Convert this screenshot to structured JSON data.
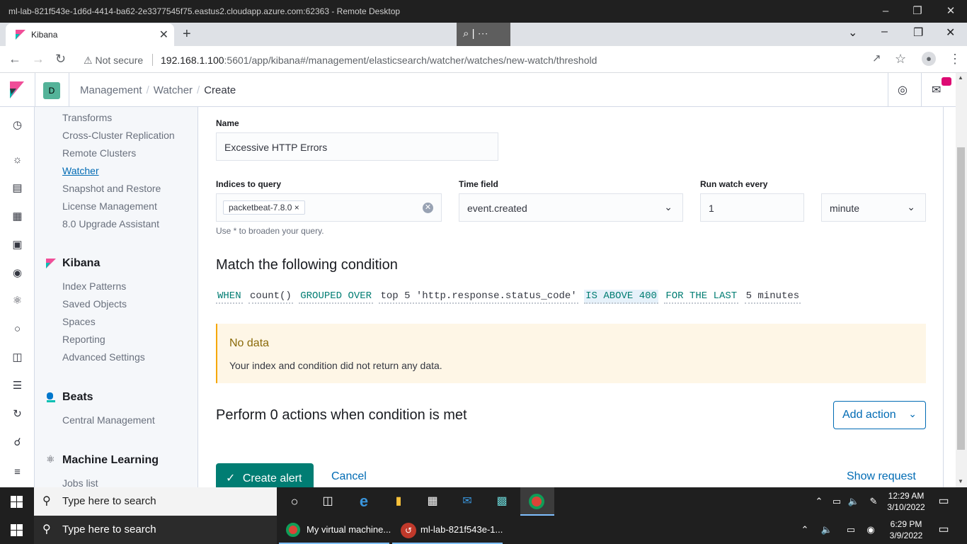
{
  "rdp": {
    "title": "ml-lab-821f543e-1d6d-4414-ba62-2e3377545f75.eastus2.cloudapp.azure.com:62363 - Remote Desktop",
    "zoom_label": "⌕ | ⋯"
  },
  "browser": {
    "tab_title": "Kibana",
    "security_label": "Not secure",
    "url_host": "192.168.1.100",
    "url_rest": ":5601/app/kibana#/management/elasticsearch/watcher/watches/new-watch/threshold"
  },
  "kibana_header": {
    "space_initial": "D",
    "breadcrumbs": [
      "Management",
      "Watcher",
      "Create"
    ]
  },
  "sidemenu": {
    "elasticsearch_items": [
      {
        "label": "Transforms"
      },
      {
        "label": "Cross-Cluster Replication"
      },
      {
        "label": "Remote Clusters"
      },
      {
        "label": "Watcher"
      },
      {
        "label": "Snapshot and Restore"
      },
      {
        "label": "License Management"
      },
      {
        "label": "8.0 Upgrade Assistant"
      }
    ],
    "kibana_heading": "Kibana",
    "kibana_items": [
      {
        "label": "Index Patterns"
      },
      {
        "label": "Saved Objects"
      },
      {
        "label": "Spaces"
      },
      {
        "label": "Reporting"
      },
      {
        "label": "Advanced Settings"
      }
    ],
    "beats_heading": "Beats",
    "beats_items": [
      {
        "label": "Central Management"
      }
    ],
    "ml_heading": "Machine Learning",
    "ml_items": [
      {
        "label": "Jobs list"
      }
    ]
  },
  "form": {
    "name_label": "Name",
    "name_value": "Excessive HTTP Errors",
    "indices_label": "Indices to query",
    "indices_badge": "packetbeat-7.8.0 ×",
    "indices_help": "Use * to broaden your query.",
    "time_field_label": "Time field",
    "time_field_value": "event.created",
    "run_every_label": "Run watch every",
    "run_every_value": "1",
    "run_every_unit": "minute"
  },
  "condition": {
    "heading": "Match the following condition",
    "when": "WHEN",
    "agg": "count()",
    "grouped": "GROUPED OVER",
    "group_value": "top 5 'http.response.status_code'",
    "threshold": "IS ABOVE 400",
    "for_the_last": "FOR THE LAST",
    "window": "5 minutes"
  },
  "callout": {
    "title": "No data",
    "text": "Your index and condition did not return any data."
  },
  "actions": {
    "heading": "Perform 0 actions when condition is met",
    "add_label": "Add action"
  },
  "footer": {
    "create_label": "Create alert",
    "cancel_label": "Cancel",
    "show_request_label": "Show request"
  },
  "taskbar_remote": {
    "search_placeholder": "Type here to search",
    "time": "12:29 AM",
    "date": "3/10/2022"
  },
  "taskbar_local": {
    "search_placeholder": "Type here to search",
    "app1": "My virtual machine...",
    "app2": "ml-lab-821f543e-1...",
    "time": "6:29 PM",
    "date": "3/9/2022"
  }
}
